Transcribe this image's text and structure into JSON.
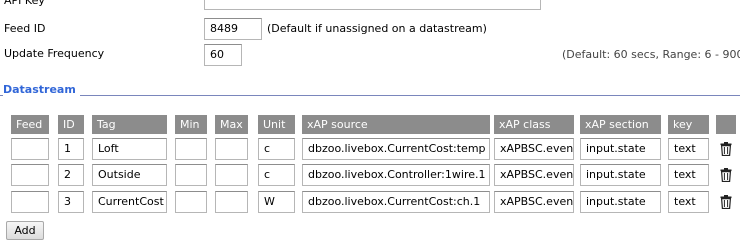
{
  "settings": {
    "api_key": {
      "label": "API Key",
      "value": ""
    },
    "feed_id": {
      "label": "Feed ID",
      "value": "8489",
      "hint": "(Default if unassigned on a datastream)"
    },
    "update_frequency": {
      "label": "Update Frequency",
      "value": "60",
      "hint": "(Default: 60 secs, Range: 6 - 900)"
    }
  },
  "datastream": {
    "legend": "Datastream",
    "columns": [
      "Feed",
      "ID",
      "Tag",
      "Min",
      "Max",
      "Unit",
      "xAP source",
      "xAP class",
      "xAP section",
      "key",
      ""
    ],
    "rows": [
      {
        "feed": "",
        "id": "1",
        "tag": "Loft",
        "min": "",
        "max": "",
        "unit": "c",
        "source": "dbzoo.livebox.CurrentCost:temp",
        "class": "xAPBSC.event",
        "section": "input.state",
        "key": "text"
      },
      {
        "feed": "",
        "id": "2",
        "tag": "Outside",
        "min": "",
        "max": "",
        "unit": "c",
        "source": "dbzoo.livebox.Controller:1wire.1",
        "class": "xAPBSC.event",
        "section": "input.state",
        "key": "text"
      },
      {
        "feed": "",
        "id": "3",
        "tag": "CurrentCost",
        "min": "",
        "max": "",
        "unit": "W",
        "source": "dbzoo.livebox.CurrentCost:ch.1",
        "class": "xAPBSC.event",
        "section": "input.state",
        "key": "text"
      }
    ],
    "delete_icon": "trash-icon",
    "add_label": "Add"
  },
  "colors": {
    "legend": "#3166d8",
    "header_bg": "#8c8c8c",
    "header_text": "#ffffff"
  }
}
